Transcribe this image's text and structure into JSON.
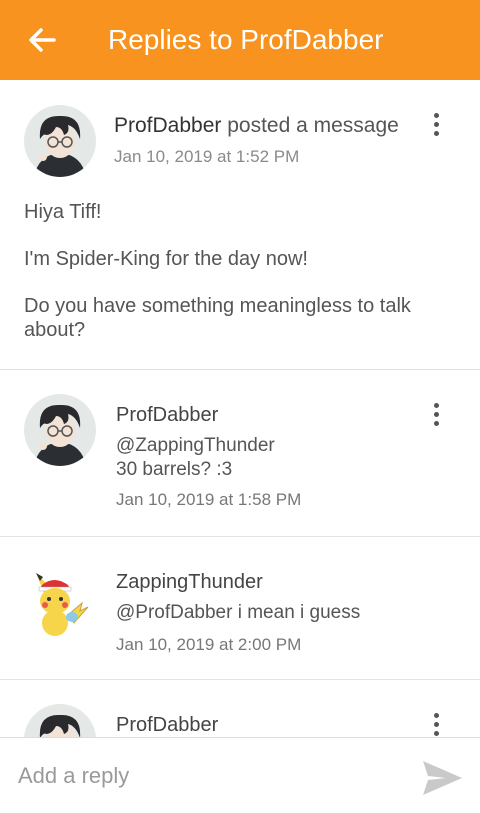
{
  "appbar": {
    "title": "Replies to ProfDabber",
    "back_icon": "arrow-left-icon",
    "background": "#f7931e"
  },
  "post": {
    "author": "ProfDabber",
    "action": "posted a message",
    "time": "Jan 10, 2019 at 1:52 PM",
    "body": [
      "Hiya Tiff!",
      "I'm Spider-King for the day now!",
      "Do you have something meaningless to talk about?"
    ]
  },
  "replies": [
    {
      "author": "ProfDabber",
      "text_lines": [
        "@ZappingThunder",
        "30 barrels? :3"
      ],
      "time": "Jan 10, 2019 at 1:58 PM"
    },
    {
      "author": "ZappingThunder",
      "text_lines": [
        "@ProfDabber i mean i guess"
      ],
      "time": "Jan 10, 2019 at 2:00 PM"
    },
    {
      "author": "ProfDabber"
    }
  ],
  "composer": {
    "placeholder": "Add a reply",
    "send_icon": "send-icon"
  }
}
